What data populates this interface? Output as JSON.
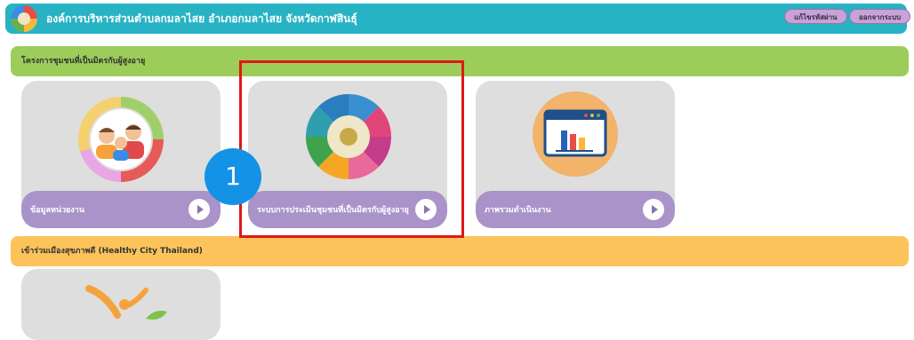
{
  "header": {
    "title": "องค์การบริหารส่วนตำบลกมลาไสย อำเภอกมลาไสย จังหวัดกาฬสินธุ์",
    "change_password_label": "แก้ไขรหัสผ่าน",
    "logout_label": "ออกจากระบบ"
  },
  "sections": [
    {
      "title": "โครงการชุมชนที่เป็นมิตรกับผู้สูงอายุ"
    },
    {
      "title": "เข้าร่วมเมืองสุขภาพดี (Healthy City Thailand)"
    }
  ],
  "cards": [
    {
      "label": "ข้อมูลหน่วยงาน",
      "icon": "people-donut-icon"
    },
    {
      "label": "ระบบการประเมินชุมชนที่เป็นมิตรกับผู้สูงอายุ",
      "icon": "assessment-wheel-icon"
    },
    {
      "label": "ภาพรวมดำเนินงาน",
      "icon": "bar-chart-window-icon"
    },
    {
      "label": "",
      "icon": "healthy-person-leaf-icon"
    }
  ],
  "annotation": {
    "step_number": "1",
    "highlight_color": "#e01818",
    "marker_color": "#1493e6"
  },
  "colors": {
    "topbar": "#27b3c4",
    "section_green": "#9ccd5a",
    "section_orange": "#fcc35b",
    "card_footer": "#a993c9"
  }
}
